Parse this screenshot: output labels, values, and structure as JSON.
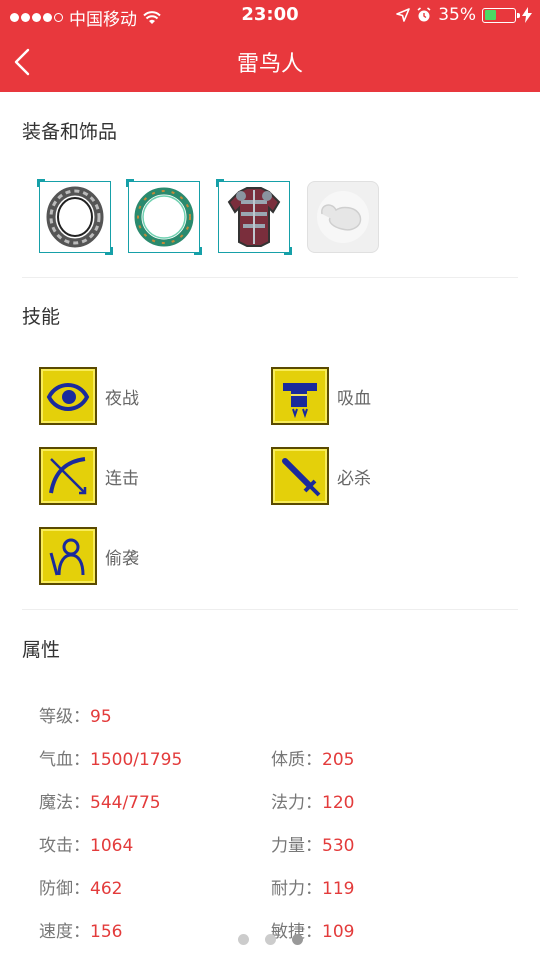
{
  "status_bar": {
    "carrier": "中国移动",
    "time": "23:00",
    "battery_percent": "35%",
    "battery_level": 0.35
  },
  "navbar": {
    "title": "雷鸟人"
  },
  "sections": {
    "equipment_title": "装备和饰品",
    "skills_title": "技能",
    "attributes_title": "属性"
  },
  "equipment": [
    {
      "icon": "dark-ring-icon"
    },
    {
      "icon": "jade-ring-icon"
    },
    {
      "icon": "armor-icon"
    },
    {
      "icon": "empty-slot-icon"
    }
  ],
  "skills": [
    {
      "label": "夜战",
      "icon": "eye-icon"
    },
    {
      "label": "吸血",
      "icon": "fang-icon"
    },
    {
      "label": "连击",
      "icon": "bow-icon"
    },
    {
      "label": "必杀",
      "icon": "sword-icon"
    },
    {
      "label": "偷袭",
      "icon": "figure-icon"
    }
  ],
  "attributes": {
    "level": {
      "key": "等级：",
      "value": "95"
    },
    "hp": {
      "key": "气血：",
      "value": "1500/1795"
    },
    "constitution": {
      "key": "体质：",
      "value": "205"
    },
    "mp": {
      "key": "魔法：",
      "value": "544/775"
    },
    "magic_power": {
      "key": "法力：",
      "value": "120"
    },
    "attack": {
      "key": "攻击：",
      "value": "1064"
    },
    "strength": {
      "key": "力量：",
      "value": "530"
    },
    "defense": {
      "key": "防御：",
      "value": "462"
    },
    "endurance": {
      "key": "耐力：",
      "value": "119"
    },
    "speed": {
      "key": "速度：",
      "value": "156"
    },
    "agility": {
      "key": "敏捷：",
      "value": "109"
    }
  },
  "pager": {
    "pages": 3,
    "active_index": 2
  },
  "colors": {
    "header": "#e8383d",
    "value": "#e33b3b",
    "skill_bg": "#e4d00a"
  }
}
